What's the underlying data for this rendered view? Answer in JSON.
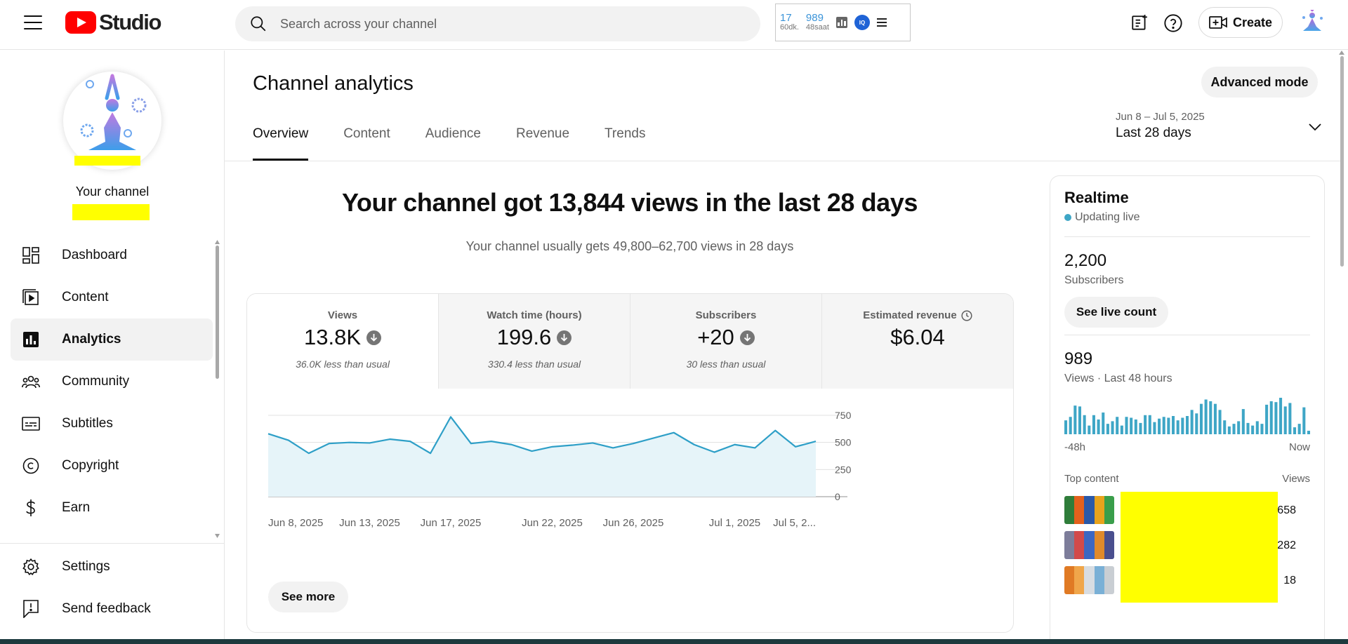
{
  "header": {
    "logo_text": "Studio",
    "search_placeholder": "Search across your channel",
    "extension": {
      "stat1_value": "17",
      "stat1_unit": "60dk.",
      "stat2_value": "989",
      "stat2_unit": "48saat",
      "badge": "IQ"
    },
    "create_label": "Create"
  },
  "sidebar": {
    "channel_label": "Your channel",
    "items": [
      {
        "label": "Dashboard",
        "icon": "dashboard-icon"
      },
      {
        "label": "Content",
        "icon": "content-icon"
      },
      {
        "label": "Analytics",
        "icon": "analytics-icon",
        "active": true
      },
      {
        "label": "Community",
        "icon": "community-icon"
      },
      {
        "label": "Subtitles",
        "icon": "subtitles-icon"
      },
      {
        "label": "Copyright",
        "icon": "copyright-icon"
      },
      {
        "label": "Earn",
        "icon": "earn-icon"
      }
    ],
    "bottom_items": [
      {
        "label": "Settings",
        "icon": "gear-icon"
      },
      {
        "label": "Send feedback",
        "icon": "feedback-icon"
      }
    ]
  },
  "main": {
    "title": "Channel analytics",
    "advanced_mode_label": "Advanced mode",
    "tabs": [
      {
        "label": "Overview",
        "active": true
      },
      {
        "label": "Content"
      },
      {
        "label": "Audience"
      },
      {
        "label": "Revenue"
      },
      {
        "label": "Trends"
      }
    ],
    "date_range": {
      "range": "Jun 8 – Jul 5, 2025",
      "label": "Last 28 days"
    },
    "headline": "Your channel got 13,844 views in the last 28 days",
    "subline": "Your channel usually gets 49,800–62,700 views in 28 days",
    "metrics": [
      {
        "label": "Views",
        "value": "13.8K",
        "comparison": "36.0K less than usual",
        "trend": "down"
      },
      {
        "label": "Watch time (hours)",
        "value": "199.6",
        "comparison": "330.4 less than usual",
        "trend": "down"
      },
      {
        "label": "Subscribers",
        "value": "+20",
        "comparison": "30 less than usual",
        "trend": "down"
      },
      {
        "label": "Estimated revenue",
        "value": "$6.04",
        "comparison": "",
        "trend": "none"
      }
    ],
    "see_more_label": "See more"
  },
  "chart_data": {
    "type": "area",
    "x": [
      "Jun 8, 2025",
      "Jun 9, 2025",
      "Jun 10, 2025",
      "Jun 11, 2025",
      "Jun 12, 2025",
      "Jun 13, 2025",
      "Jun 14, 2025",
      "Jun 15, 2025",
      "Jun 16, 2025",
      "Jun 17, 2025",
      "Jun 18, 2025",
      "Jun 19, 2025",
      "Jun 20, 2025",
      "Jun 21, 2025",
      "Jun 22, 2025",
      "Jun 23, 2025",
      "Jun 24, 2025",
      "Jun 25, 2025",
      "Jun 26, 2025",
      "Jun 27, 2025",
      "Jun 28, 2025",
      "Jun 29, 2025",
      "Jun 30, 2025",
      "Jul 1, 2025",
      "Jul 2, 2025",
      "Jul 3, 2025",
      "Jul 4, 2025",
      "Jul 5, 2025"
    ],
    "values": [
      580,
      520,
      400,
      490,
      500,
      495,
      530,
      510,
      400,
      735,
      490,
      510,
      480,
      420,
      460,
      475,
      495,
      450,
      490,
      540,
      590,
      480,
      410,
      480,
      450,
      610,
      460,
      510
    ],
    "x_tick_labels": [
      "Jun 8, 2025",
      "Jun 13, 2025",
      "Jun 17, 2025",
      "Jun 22, 2025",
      "Jun 26, 2025",
      "Jul 1, 2025",
      "Jul 5, 2..."
    ],
    "x_tick_index": [
      0,
      5,
      9,
      14,
      18,
      23,
      27
    ],
    "y_ticks": [
      0,
      250,
      500,
      750
    ],
    "ylim": [
      0,
      750
    ],
    "grid": true,
    "line_color": "#2e9fc7",
    "fill_color": "#e6f4f9"
  },
  "realtime": {
    "title": "Realtime",
    "status": "Updating live",
    "subscribers_value": "2,200",
    "subscribers_label": "Subscribers",
    "live_count_label": "See live count",
    "views_value": "989",
    "views_label": "Views · Last 48 hours",
    "axis_start": "-48h",
    "axis_end": "Now",
    "bars": [
      16,
      20,
      33,
      32,
      22,
      10,
      22,
      17,
      25,
      12,
      15,
      20,
      10,
      20,
      19,
      17,
      13,
      22,
      22,
      14,
      18,
      20,
      19,
      21,
      16,
      19,
      21,
      28,
      24,
      35,
      40,
      38,
      35,
      28,
      16,
      9,
      12,
      15,
      29,
      13,
      10,
      15,
      12,
      34,
      38,
      37,
      42,
      32,
      36,
      8,
      12,
      31,
      4
    ],
    "top_content_label": "Top content",
    "top_views_label": "Views",
    "top_content_views": [
      "658",
      "282",
      "18"
    ],
    "accent": "#3ea6c6"
  }
}
